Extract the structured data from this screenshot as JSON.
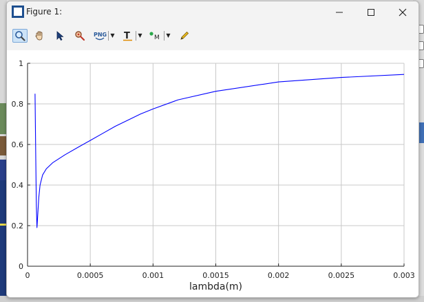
{
  "window": {
    "title": "Figure 1:"
  },
  "toolbar": {
    "items": [
      {
        "name": "zoom-tool-button",
        "icon": "magnifier-icon",
        "active": true
      },
      {
        "name": "pan-tool-button",
        "icon": "hand-icon",
        "active": false
      },
      {
        "name": "select-tool-button",
        "icon": "arrow-pointer-icon",
        "active": false
      },
      {
        "name": "data-cursor-button",
        "icon": "pin-magnifier-icon",
        "active": false
      },
      {
        "name": "export-png-dropdown",
        "icon": "png-icon",
        "label": "PNG",
        "active": false
      },
      {
        "name": "text-tool-dropdown",
        "icon": "text-t-icon",
        "label": "T",
        "active": false
      },
      {
        "name": "marker-tool-dropdown",
        "icon": "marker-m-icon",
        "label": "M",
        "active": false
      },
      {
        "name": "edit-pencil-button",
        "icon": "pencil-icon",
        "active": false
      }
    ]
  },
  "chart_data": {
    "type": "line",
    "title": "",
    "xlabel": "lambda(m)",
    "ylabel": "",
    "xlim": [
      0,
      0.003
    ],
    "ylim": [
      0,
      1
    ],
    "xticks": [
      "0",
      "0.0005",
      "0.001",
      "0.0015",
      "0.002",
      "0.0025",
      "0.003"
    ],
    "yticks": [
      "0",
      "0.2",
      "0.4",
      "0.6",
      "0.8",
      "1"
    ],
    "grid": true,
    "line_color": "#0000ff",
    "series": [
      {
        "x": [
          6e-05,
          6.5e-05,
          7e-05,
          7.5e-05,
          8e-05,
          9e-05,
          0.0001,
          0.00012,
          0.00015,
          0.0002,
          0.00025,
          0.0003,
          0.0004,
          0.0005,
          0.0006,
          0.0007,
          0.0008,
          0.0009,
          0.001,
          0.0012,
          0.0015,
          0.002,
          0.0025,
          0.003
        ],
        "y": [
          0.85,
          0.55,
          0.3,
          0.19,
          0.24,
          0.34,
          0.4,
          0.45,
          0.48,
          0.51,
          0.53,
          0.55,
          0.585,
          0.62,
          0.655,
          0.69,
          0.72,
          0.75,
          0.775,
          0.82,
          0.862,
          0.908,
          0.93,
          0.945
        ]
      }
    ]
  }
}
